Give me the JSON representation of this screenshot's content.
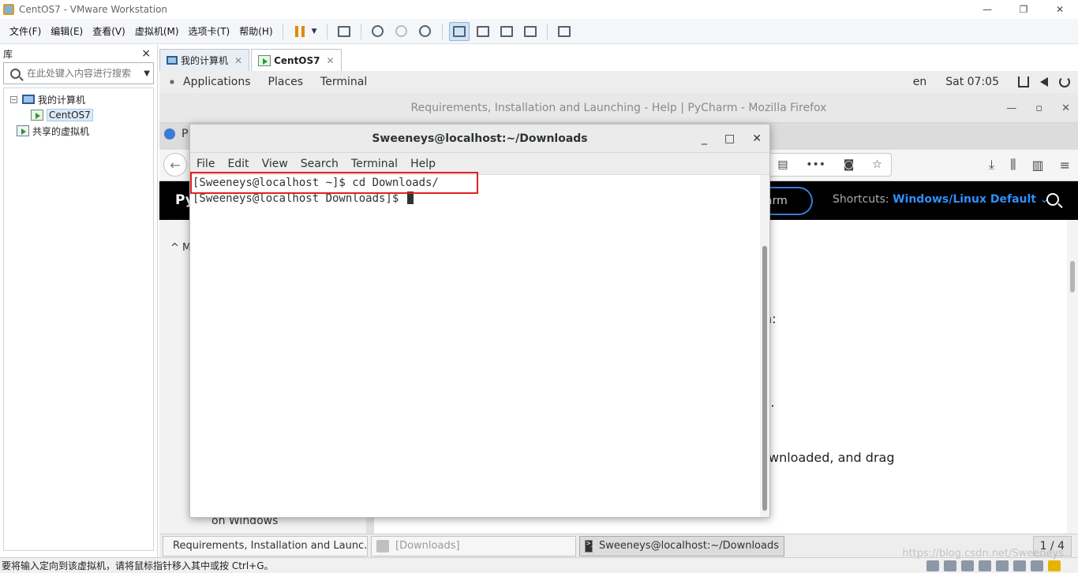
{
  "vmware": {
    "title": "CentOS7 - VMware Workstation",
    "menus": [
      "文件(F)",
      "编辑(E)",
      "查看(V)",
      "虚拟机(M)",
      "选项卡(T)",
      "帮助(H)"
    ],
    "library": {
      "title": "库",
      "close": "×",
      "search_placeholder": "在此处键入内容进行搜索",
      "tree": {
        "my_computer": "我的计算机",
        "centos": "CentOS7",
        "shared": "共享的虚拟机"
      }
    },
    "tabs": [
      {
        "label": "我的计算机"
      },
      {
        "label": "CentOS7"
      }
    ],
    "status_message": "要将输入定向到该虚拟机，请将鼠标指针移入其中或按 Ctrl+G。"
  },
  "gnome": {
    "applications": "Applications",
    "places": "Places",
    "terminal": "Terminal",
    "lang": "en",
    "clock": "Sat 07:05",
    "taskbar": [
      {
        "label": "Requirements, Installation and Launc..."
      },
      {
        "label": "[Downloads]"
      },
      {
        "label": "Sweeneys@localhost:~/Downloads"
      }
    ],
    "workspace": "1 / 4"
  },
  "firefox": {
    "window_title": "Requirements, Installation and Launching - Help | PyCharm - Mozilla Firefox",
    "tab_fragment": "P",
    "logo_fragment": "Py",
    "pill_fragment": "arm",
    "shortcuts_label": "Shortcuts:",
    "shortcuts_value": "Windows/Linux Default",
    "sidebar_fragment": "M",
    "sidebar_bottom": "on Windows",
    "content": {
      "line1": "n:",
      "line2": "l.",
      "line3": "wnloaded, and drag"
    }
  },
  "terminal": {
    "title": "Sweeneys@localhost:~/Downloads",
    "menu": [
      "File",
      "Edit",
      "View",
      "Search",
      "Terminal",
      "Help"
    ],
    "lines": [
      "[Sweeneys@localhost ~]$ cd Downloads/",
      "[Sweeneys@localhost Downloads]$ "
    ]
  },
  "watermark": "https://blog.csdn.net/Sweeneys"
}
